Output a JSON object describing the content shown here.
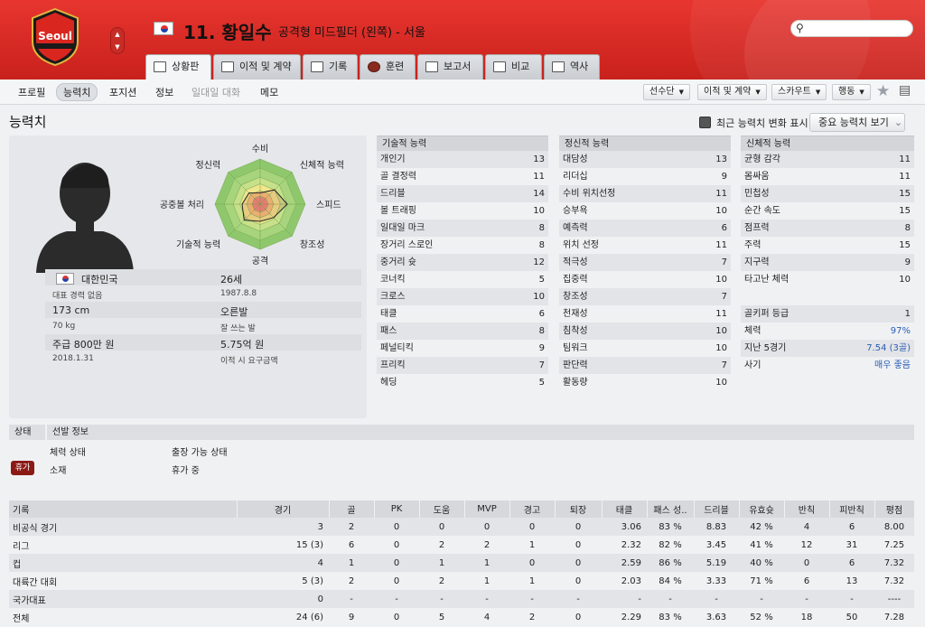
{
  "header": {
    "club_crest_text": "Seoul",
    "player_title": "11. 황일수",
    "position_club": "공격형 미드필더 (왼쪽) - 서울",
    "tabs": [
      "상황판",
      "이적 및 계약",
      "기록",
      "훈련",
      "보고서",
      "비교",
      "역사"
    ]
  },
  "subnav": {
    "items": [
      "프로필",
      "능력치",
      "포지션",
      "정보",
      "일대일 대화",
      "메모"
    ],
    "dropdowns": [
      "선수단",
      "이적 및 계약",
      "스카우트",
      "행동"
    ]
  },
  "page_title": "능력치",
  "toolbar": {
    "history_toggle": "최근 능력치 변화 표시",
    "key_attr_button": "중요 능력치 보기"
  },
  "radar": {
    "labels": [
      "수비",
      "신체적 능력",
      "스피드",
      "창조성",
      "공격",
      "기술적 능력",
      "공중볼 처리",
      "정신력"
    ],
    "values": [
      0.25,
      0.45,
      0.6,
      0.42,
      0.38,
      0.5,
      0.4,
      0.35
    ]
  },
  "profile": {
    "nationality": "대한민국",
    "caps": "대표 경력 없음",
    "height": "173 cm",
    "weight": "70 kg",
    "wage": "주급 800만 원",
    "contract_end": "2018.1.31",
    "age": "26세",
    "dob": "1987.8.8",
    "foot": "오른발",
    "foot_note": "잘 쓰는 발",
    "value": "5.75억 원",
    "value_note": "이적 시 요구금액"
  },
  "technical": {
    "header": "기술적 능력",
    "rows": [
      {
        "name": "개인기",
        "value": "13"
      },
      {
        "name": "골 결정력",
        "value": "11"
      },
      {
        "name": "드리블",
        "value": "14"
      },
      {
        "name": "볼 트래핑",
        "value": "10"
      },
      {
        "name": "일대일 마크",
        "value": "8"
      },
      {
        "name": "장거리 스로인",
        "value": "8"
      },
      {
        "name": "중거리 슛",
        "value": "12"
      },
      {
        "name": "코너킥",
        "value": "5"
      },
      {
        "name": "크로스",
        "value": "10"
      },
      {
        "name": "태클",
        "value": "6"
      },
      {
        "name": "패스",
        "value": "8"
      },
      {
        "name": "페널티킥",
        "value": "9"
      },
      {
        "name": "프리킥",
        "value": "7"
      },
      {
        "name": "헤딩",
        "value": "5"
      }
    ]
  },
  "mental": {
    "header": "정신적 능력",
    "rows": [
      {
        "name": "대담성",
        "value": "13"
      },
      {
        "name": "리더십",
        "value": "9"
      },
      {
        "name": "수비 위치선정",
        "value": "11"
      },
      {
        "name": "승부욕",
        "value": "10"
      },
      {
        "name": "예측력",
        "value": "6"
      },
      {
        "name": "위치 선정",
        "value": "11"
      },
      {
        "name": "적극성",
        "value": "7"
      },
      {
        "name": "집중력",
        "value": "10"
      },
      {
        "name": "창조성",
        "value": "7"
      },
      {
        "name": "천재성",
        "value": "11"
      },
      {
        "name": "침착성",
        "value": "10"
      },
      {
        "name": "팀워크",
        "value": "10"
      },
      {
        "name": "판단력",
        "value": "7"
      },
      {
        "name": "활동량",
        "value": "10"
      }
    ]
  },
  "physical": {
    "header": "신체적 능력",
    "rows": [
      {
        "name": "균형 감각",
        "value": "11"
      },
      {
        "name": "몸싸움",
        "value": "11"
      },
      {
        "name": "민첩성",
        "value": "15"
      },
      {
        "name": "순간 속도",
        "value": "15"
      },
      {
        "name": "점프력",
        "value": "8"
      },
      {
        "name": "주력",
        "value": "15"
      },
      {
        "name": "지구력",
        "value": "9"
      },
      {
        "name": "타고난 체력",
        "value": "10"
      }
    ],
    "extra": [
      {
        "name": "골키퍼 등급",
        "value": "1"
      },
      {
        "name": "체력",
        "value": "97%"
      },
      {
        "name": "지난 5경기",
        "value": "7.54 (3골)"
      },
      {
        "name": "사기",
        "value": "매우 좋음"
      }
    ]
  },
  "status": {
    "header_left": "상태",
    "header_right": "선발 정보",
    "condition_label": "체력 상태",
    "availability_label": "출장 가능 상태",
    "badge": "휴가",
    "condition_value": "소재",
    "availability_value": "휴가 중"
  },
  "stats": {
    "columns": [
      "기록",
      "경기",
      "골",
      "PK",
      "도움",
      "MVP",
      "경고",
      "퇴장",
      "태클",
      "패스 성..",
      "드리블",
      "유효슛",
      "반칙",
      "피반칙",
      "평점"
    ],
    "rows": [
      [
        "비공식 경기",
        "3",
        "2",
        "0",
        "0",
        "0",
        "0",
        "0",
        "3.06",
        "83 %",
        "8.83",
        "42 %",
        "4",
        "6",
        "8.00"
      ],
      [
        "리그",
        "15 (3)",
        "6",
        "0",
        "2",
        "2",
        "1",
        "0",
        "2.32",
        "82 %",
        "3.45",
        "41 %",
        "12",
        "31",
        "7.25"
      ],
      [
        "컵",
        "4",
        "1",
        "0",
        "1",
        "1",
        "0",
        "0",
        "2.59",
        "86 %",
        "5.19",
        "40 %",
        "0",
        "6",
        "7.32"
      ],
      [
        "대륙간 대회",
        "5 (3)",
        "2",
        "0",
        "2",
        "1",
        "1",
        "0",
        "2.03",
        "84 %",
        "3.33",
        "71 %",
        "6",
        "13",
        "7.32"
      ],
      [
        "국가대표",
        "0",
        "-",
        "-",
        "-",
        "-",
        "-",
        "-",
        "-",
        "-",
        "-",
        "-",
        "-",
        "-",
        "----"
      ],
      [
        "전체",
        "24 (6)",
        "9",
        "0",
        "5",
        "4",
        "2",
        "0",
        "2.29",
        "83 %",
        "3.63",
        "52 %",
        "18",
        "50",
        "7.28"
      ]
    ]
  }
}
